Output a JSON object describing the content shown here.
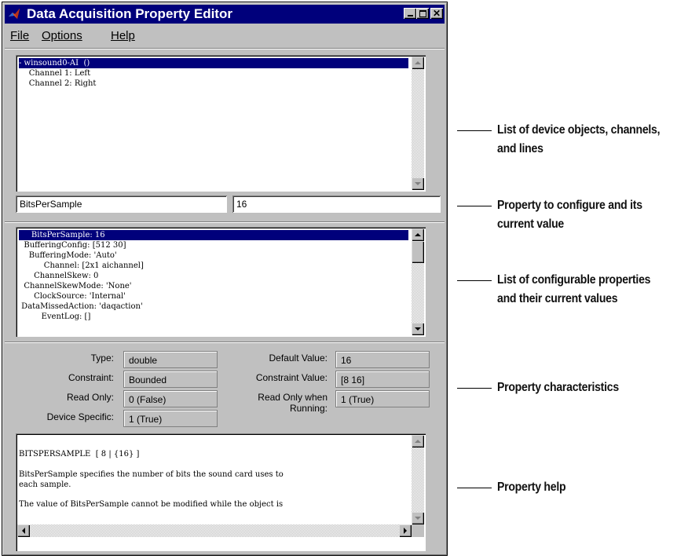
{
  "window": {
    "title": "Data Acquisition Property Editor",
    "titlebar_color": "#00007b",
    "controls": [
      "minimize-icon",
      "maximize-icon",
      "close-icon"
    ]
  },
  "menu": [
    "File",
    "Options",
    "Help"
  ],
  "object_list": {
    "rows": [
      "- winsound0-AI  ()",
      "    Channel 1: Left",
      "    Channel 2: Right"
    ],
    "selected_index": 0
  },
  "property_edit": {
    "name": "BitsPerSample",
    "value": "16"
  },
  "property_list": {
    "rows": [
      "     BitsPerSample: 16",
      "  BufferingConfig: [512 30]",
      "    BufferingMode: 'Auto'",
      "          Channel: [2x1 aichannel]",
      "      ChannelSkew: 0",
      "  ChannelSkewMode: 'None'",
      "      ClockSource: 'Internal'",
      " DataMissedAction: 'daqaction'",
      "         EventLog: []"
    ],
    "selected_index": 0
  },
  "characteristics": {
    "type_label": "Type:",
    "type_value": "double",
    "constraint_label": "Constraint:",
    "constraint_value": "Bounded",
    "readonly_label": "Read Only:",
    "readonly_value": "0 (False)",
    "devspec_label": "Device Specific:",
    "devspec_value": "1 (True)",
    "default_label": "Default Value:",
    "default_value": "16",
    "cvalue_label": "Constraint Value:",
    "cvalue_value": "[8 16]",
    "rorun_label_1": "Read Only when",
    "rorun_label_2": "Running:",
    "rorun_value": "1 (True)"
  },
  "help": {
    "lines": [
      "BITSPERSAMPLE  [ 8 | {16} ]",
      "",
      "BitsPerSample specifies the number of bits the sound card uses to",
      "each sample.",
      "",
      "The value of BitsPerSample cannot be modified while the object is"
    ]
  },
  "annotations": {
    "a1_line1": "List of device objects, channels,",
    "a1_line2": "and lines",
    "a2_line1": "Property to configure and its",
    "a2_line2": "current value",
    "a3_line1": "List of configurable properties",
    "a3_line2": "and their current values",
    "a4_line1": "Property characteristics",
    "a5_line1": "Property help"
  }
}
